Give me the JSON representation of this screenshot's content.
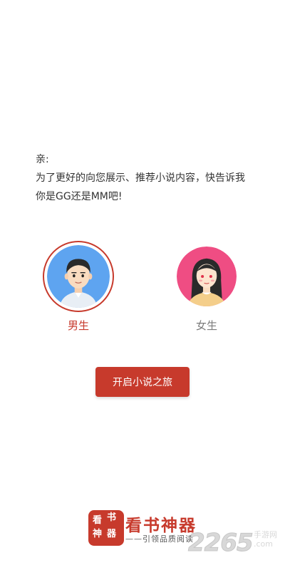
{
  "intro": {
    "greeting": "亲:",
    "line1": "为了更好的向您展示、推荐小说内容，快告诉我",
    "line2": "你是GG还是MM吧!"
  },
  "genders": {
    "male": {
      "label": "男生",
      "selected": true,
      "color": "#c73a2c"
    },
    "female": {
      "label": "女生",
      "selected": false,
      "color": "#7b7b7b"
    }
  },
  "start_button": {
    "label": "开启小说之旅"
  },
  "footer": {
    "logo_chars": [
      "看",
      "书",
      "神",
      "器"
    ],
    "brand_name": "看书神器",
    "slogan": "——引领品质阅读"
  },
  "watermark": {
    "number": "2265",
    "suffix": "手游网",
    "url": ".com"
  },
  "colors": {
    "accent": "#c73a2c",
    "male_bg": "#5ea4f0",
    "female_bg": "#ef4d83"
  }
}
